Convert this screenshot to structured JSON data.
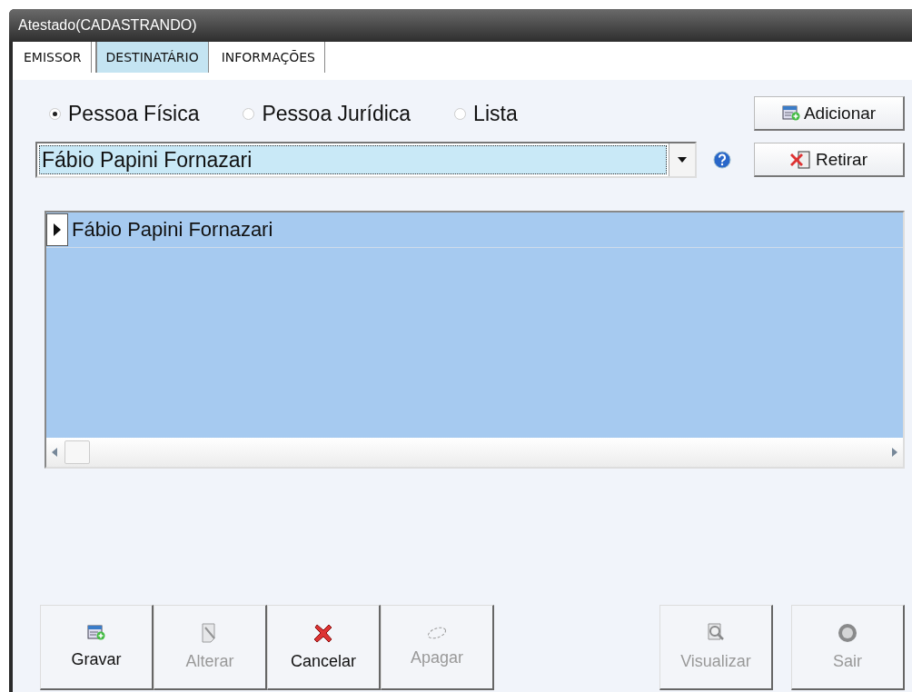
{
  "window": {
    "title": "Atestado(CADASTRANDO)"
  },
  "tabs": [
    {
      "label": "EMISSOR",
      "selected": false
    },
    {
      "label": "DESTINATÁRIO",
      "selected": true
    },
    {
      "label": "INFORMAÇÕES",
      "selected": false
    }
  ],
  "person_type": [
    {
      "label": "Pessoa Física",
      "selected": true
    },
    {
      "label": "Pessoa Jurídica",
      "selected": false
    },
    {
      "label": "Lista",
      "selected": false
    }
  ],
  "add_button": {
    "label": "Adicionar"
  },
  "combo": {
    "value": "Fábio Papini Fornazari"
  },
  "remove_button": {
    "label": "Retirar"
  },
  "grid": {
    "rows": [
      {
        "name": "Fábio Papini Fornazari",
        "selected": true
      }
    ]
  },
  "actions_left": [
    {
      "kind": "add",
      "label": "Gravar",
      "disabled": false
    },
    {
      "kind": "edit",
      "label": "Alterar",
      "disabled": true
    },
    {
      "kind": "cancel",
      "label": "Cancelar",
      "disabled": false
    },
    {
      "kind": "erase",
      "label": "Apagar",
      "disabled": true
    }
  ],
  "actions_right": [
    {
      "kind": "view",
      "label": "Visualizar",
      "disabled": true
    },
    {
      "kind": "exit",
      "label": "Sair",
      "disabled": true
    }
  ]
}
